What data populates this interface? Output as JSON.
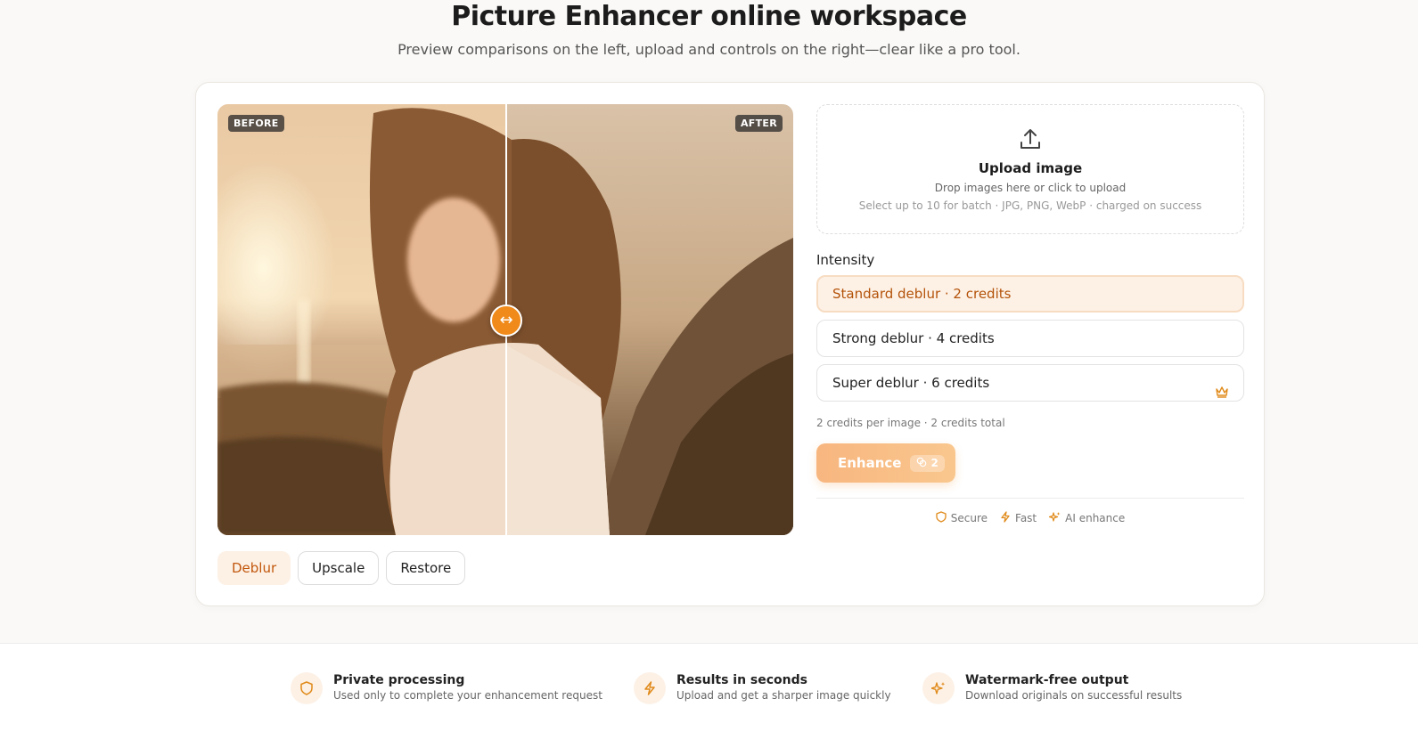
{
  "hero": {
    "title": "Picture Enhancer online workspace",
    "subtitle": "Preview comparisons on the left, upload and controls on the right—clear like a pro tool."
  },
  "preview": {
    "before_label": "BEFORE",
    "after_label": "AFTER",
    "handle_glyph": "↔"
  },
  "modes": [
    {
      "label": "Deblur",
      "active": true
    },
    {
      "label": "Upscale",
      "active": false
    },
    {
      "label": "Restore",
      "active": false
    }
  ],
  "upload": {
    "icon": "upload-icon",
    "title": "Upload image",
    "hint": "Drop images here or click to upload",
    "details": "Select up to 10 for batch · JPG, PNG, WebP · charged on success"
  },
  "intensity": {
    "label": "Intensity",
    "options": [
      {
        "label": "Standard deblur · 2 credits",
        "selected": true
      },
      {
        "label": "Strong deblur · 4 credits",
        "selected": false
      },
      {
        "label": "Super deblur · 6 credits",
        "selected": false,
        "premium": true
      }
    ]
  },
  "credits_note": "2 credits per image · 2 credits total",
  "enhance": {
    "label": "Enhance",
    "cost": "2"
  },
  "trust": [
    "Secure",
    "Fast",
    "AI enhance"
  ],
  "features": [
    {
      "title": "Private processing",
      "desc": "Used only to complete your enhancement request",
      "icon": "shield-icon"
    },
    {
      "title": "Results in seconds",
      "desc": "Upload and get a sharper image quickly",
      "icon": "bolt-icon"
    },
    {
      "title": "Watermark-free output",
      "desc": "Download originals on successful results",
      "icon": "sparkle-icon"
    }
  ],
  "colors": {
    "accent": "#f08a1a",
    "accent_soft": "#fdf1e6",
    "accent_text": "#c2570c"
  }
}
